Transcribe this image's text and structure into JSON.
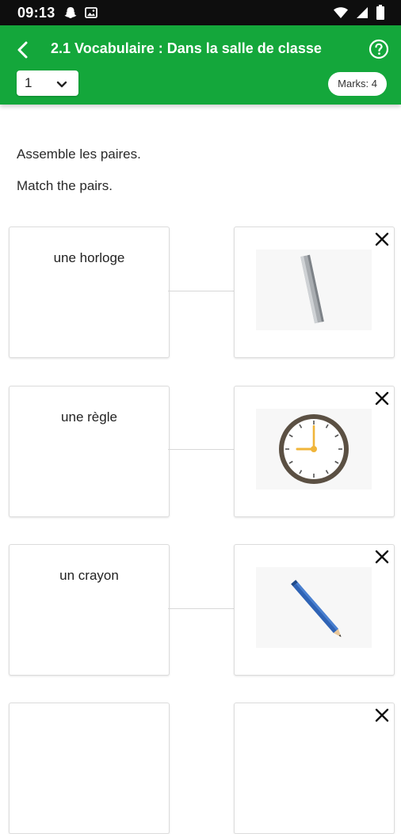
{
  "status_bar": {
    "time": "09:13",
    "icons": [
      "snapchat-icon",
      "gallery-icon",
      "wifi-icon",
      "signal-icon",
      "battery-icon"
    ]
  },
  "app_bar": {
    "title": "2.1 Vocabulaire : Dans la salle de classe",
    "background_color": "#14a73b",
    "page_select_value": "1",
    "marks_label": "Marks: 4"
  },
  "instructions": {
    "french": "Assemble les paires.",
    "english": "Match the pairs."
  },
  "pairs": [
    {
      "word": "une horloge",
      "image": "ruler-image"
    },
    {
      "word": "une règle",
      "image": "clock-image"
    },
    {
      "word": "un crayon",
      "image": "pencil-image"
    }
  ]
}
